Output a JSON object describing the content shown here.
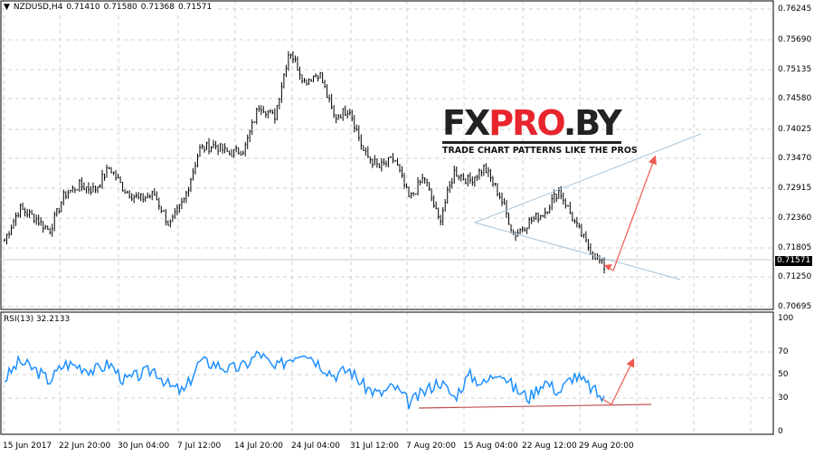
{
  "header": {
    "symbol": "NZDUSD,H4",
    "open": "0.71410",
    "high": "0.71580",
    "low": "0.71368",
    "close": "0.71571"
  },
  "price_axis": [
    "0.76245",
    "0.75690",
    "0.75135",
    "0.74580",
    "0.74025",
    "0.73470",
    "0.72915",
    "0.72360",
    "0.71805",
    "0.71250",
    "0.70695"
  ],
  "current_price": "0.71571",
  "rsi": {
    "label": "RSI(13) 32.2133",
    "axis": [
      "100",
      "70",
      "50",
      "30",
      "0"
    ]
  },
  "time_axis": [
    "15 Jun 2017",
    "22 Jun 20:00",
    "30 Jun 04:00",
    "7 Jul 12:00",
    "14 Jul 20:00",
    "24 Jul 04:00",
    "31 Jul 12:00",
    "7 Aug 20:00",
    "15 Aug 04:00",
    "22 Aug 12:00",
    "29 Aug 20:00"
  ],
  "logo": {
    "text_dark1": "FX",
    "text_red": "PRO",
    "text_dark2": ".BY",
    "tagline": "TRADE CHART PATTERNS LIKE THE PROS"
  },
  "colors": {
    "rsi_line": "#1e90ff",
    "arrow": "#f05a50",
    "trendline": "#a8c4d8",
    "support": "#c0504d"
  },
  "chart_data": [
    {
      "type": "candlestick",
      "title": "NZDUSD,H4",
      "ylim": [
        0.70695,
        0.76245
      ],
      "close_path": [
        0.7194,
        0.7253,
        0.7236,
        0.7211,
        0.7279,
        0.7296,
        0.7287,
        0.7329,
        0.7287,
        0.727,
        0.7279,
        0.722,
        0.727,
        0.7363,
        0.7371,
        0.7355,
        0.7363,
        0.7447,
        0.7422,
        0.7549,
        0.749,
        0.7506,
        0.7422,
        0.7439,
        0.7355,
        0.7329,
        0.7346,
        0.727,
        0.7312,
        0.7228,
        0.7321,
        0.7304,
        0.7329,
        0.7279,
        0.7203,
        0.7228,
        0.7245,
        0.7287,
        0.7228,
        0.7178,
        0.7144
      ]
    },
    {
      "type": "line",
      "title": "RSI(13)",
      "ylim": [
        0,
        100
      ],
      "levels": [
        70,
        50,
        30
      ],
      "values": [
        46,
        62,
        55,
        45,
        60,
        58,
        54,
        60,
        45,
        50,
        55,
        40,
        35,
        62,
        60,
        55,
        58,
        70,
        55,
        65,
        72,
        60,
        50,
        55,
        40,
        33,
        40,
        25,
        35,
        45,
        30,
        50,
        42,
        55,
        38,
        30,
        45,
        35,
        50,
        40,
        28
      ]
    }
  ]
}
